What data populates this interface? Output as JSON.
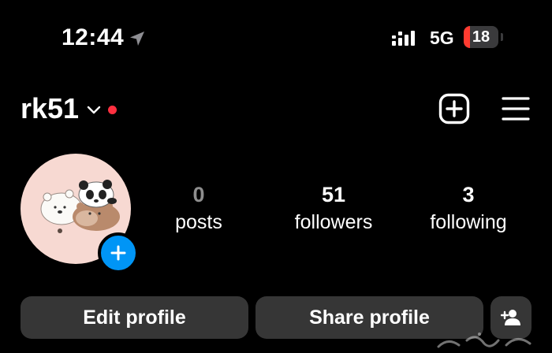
{
  "status_bar": {
    "time": "12:44",
    "network": "5G",
    "battery_level": "18",
    "battery_fraction": 0.18,
    "battery_color": "#ff3b30"
  },
  "header": {
    "username": "rk51",
    "notification_color": "#ff3040",
    "create_icon": "plus-square-icon",
    "menu_icon": "hamburger-menu-icon"
  },
  "profile": {
    "avatar_icon": "bear-avatar",
    "add_story_color": "#0095f6",
    "stats": [
      {
        "count": "0",
        "label": "posts"
      },
      {
        "count": "51",
        "label": "followers"
      },
      {
        "count": "3",
        "label": "following"
      }
    ]
  },
  "actions": {
    "edit_profile": "Edit profile",
    "share_profile": "Share profile",
    "suggest_people_icon": "add-person-icon"
  }
}
